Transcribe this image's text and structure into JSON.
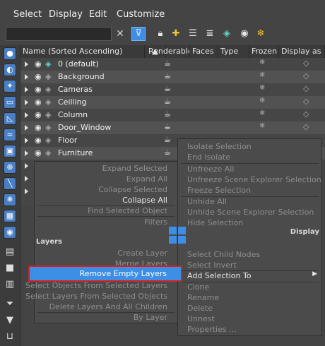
{
  "menubar": {
    "items": [
      "Select",
      "Display",
      "Edit",
      "Customize"
    ]
  },
  "toolbar": {
    "search_value": "",
    "clear_icon": "close-icon",
    "icons": [
      "filter-icon",
      "lock-icon",
      "add-layer-icon",
      "layers-icon",
      "layer-list-icon",
      "stack-icon",
      "eye-icon",
      "freeze-icon"
    ]
  },
  "leftstrip": {
    "icons": [
      "sphere-icon",
      "shapes-icon",
      "light-icon",
      "camera-icon",
      "helper-icon",
      "spacewarp-icon",
      "group-icon",
      "xref-icon",
      "bone-icon",
      "frozen-icon",
      "container-icon",
      "eye-icon",
      "layer-doc-icon",
      "white-box-icon",
      "document-icon",
      "filter-stack-icon",
      "funnel-icon",
      "container2-icon"
    ]
  },
  "header": {
    "columns": [
      "Name (Sorted Ascending)",
      "Renderable",
      "Faces",
      "Type",
      "Frozen",
      "Display as"
    ],
    "sort_indicator": "▲"
  },
  "rows": [
    {
      "name": "0 (default)",
      "default": true
    },
    {
      "name": "Background"
    },
    {
      "name": "Cameras"
    },
    {
      "name": "Ceilling"
    },
    {
      "name": "Column"
    },
    {
      "name": "Door_Window"
    },
    {
      "name": "Floor"
    },
    {
      "name": "Furniture"
    }
  ],
  "context_menu": {
    "top_right": [
      "Isolate Selection",
      "End Isolate",
      "Unfreeze All",
      "Unfreeze Scene Explorer Selection",
      "Freeze Selection",
      "Unhide All",
      "Unhide Scene Explorer Selection",
      "Hide Selection"
    ],
    "top_left": [
      "Expand Selected",
      "Expand All",
      "Collapse Selected",
      "Collapse All",
      "Find Selected Object",
      "Filters"
    ],
    "display_label": "Display",
    "layers_label": "Layers",
    "bottom_left": [
      "Create Layer",
      "Merge Layers",
      "Remove Empty Layers",
      "Select Objects From Selected Layers",
      "Select Layers From Selected Objects",
      "Delete Layers And All Children",
      "By Layer"
    ],
    "bottom_right": [
      "Select Child Nodes",
      "Select Invert",
      "Add Selection To",
      "Clone",
      "Rename",
      "Delete",
      "Unnest",
      "Properties ..."
    ],
    "highlighted": "Remove Empty Layers",
    "highlight_color": "#3d8ee5",
    "annotation_color": "#d42020"
  }
}
